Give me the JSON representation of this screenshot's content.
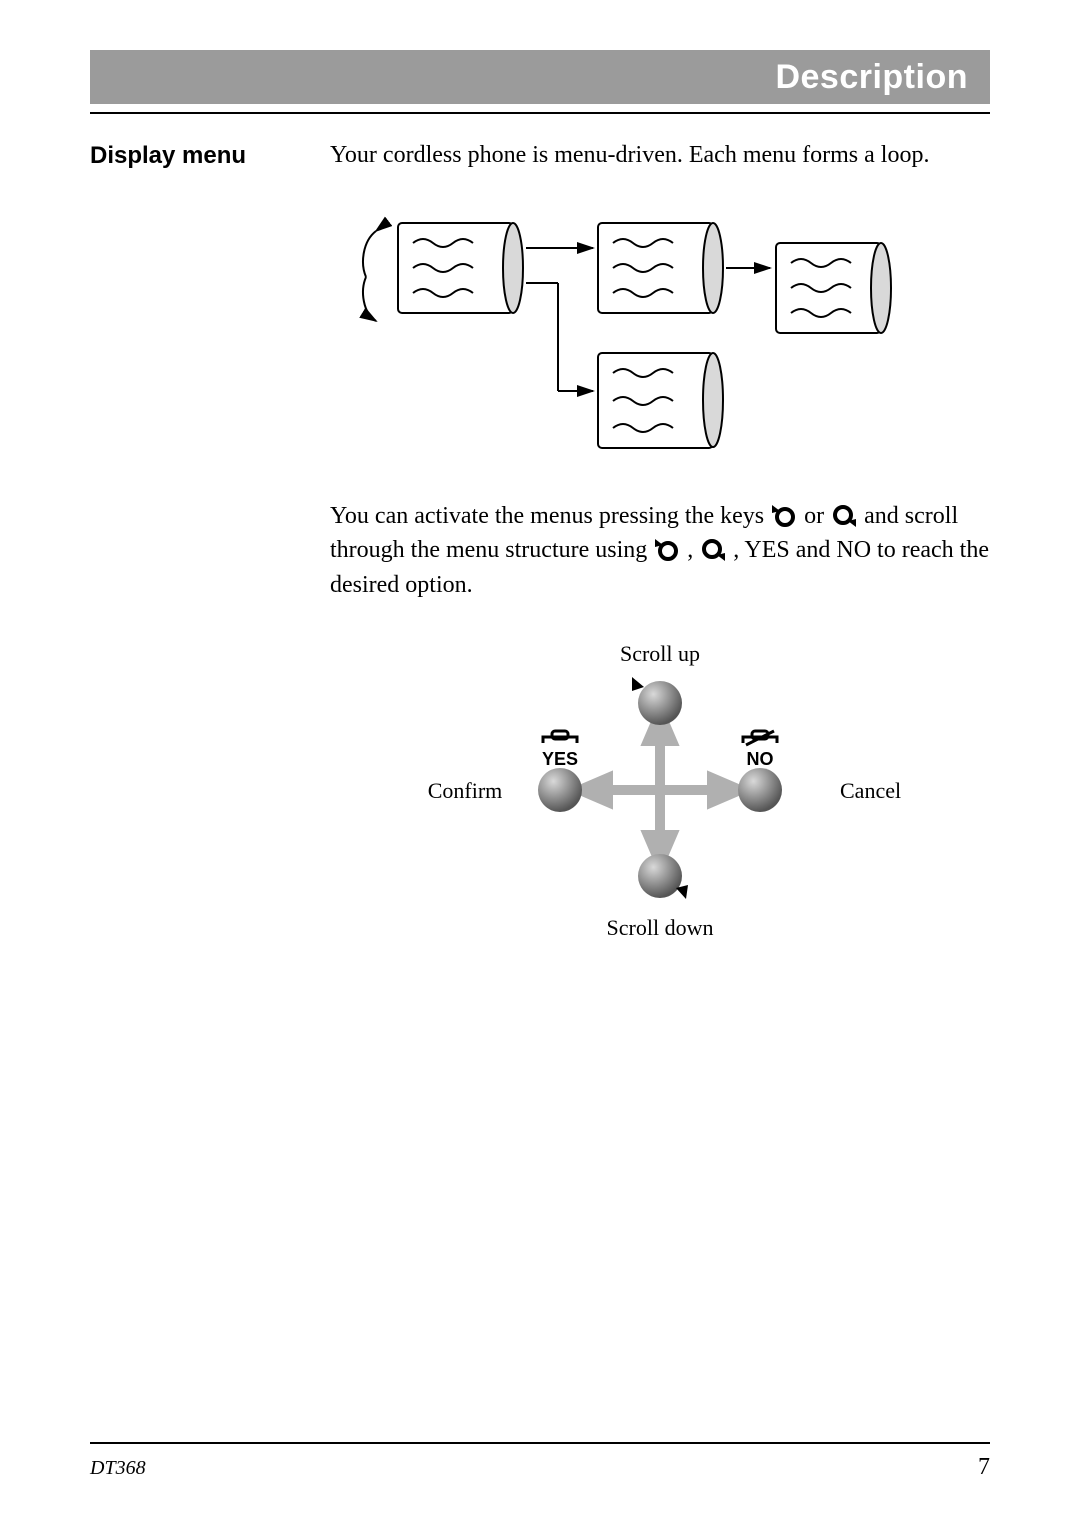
{
  "header": {
    "title": "Description"
  },
  "section": {
    "heading": "Display menu"
  },
  "body": {
    "p1": "Your cordless phone is menu-driven. Each menu forms a loop.",
    "p2a": "You can activate the menus pressing the keys ",
    "p2or": " or ",
    "p2b": " and scroll through the menu structure using ",
    "p2comma1": " , ",
    "p2comma2": " , ",
    "p2c": "YES and NO to reach the desired option."
  },
  "labels": {
    "scroll_up": "Scroll up",
    "scroll_down": "Scroll down",
    "confirm": "Confirm",
    "cancel": "Cancel",
    "yes": "YES",
    "no": "NO"
  },
  "footer": {
    "model": "DT368",
    "page": "7"
  }
}
